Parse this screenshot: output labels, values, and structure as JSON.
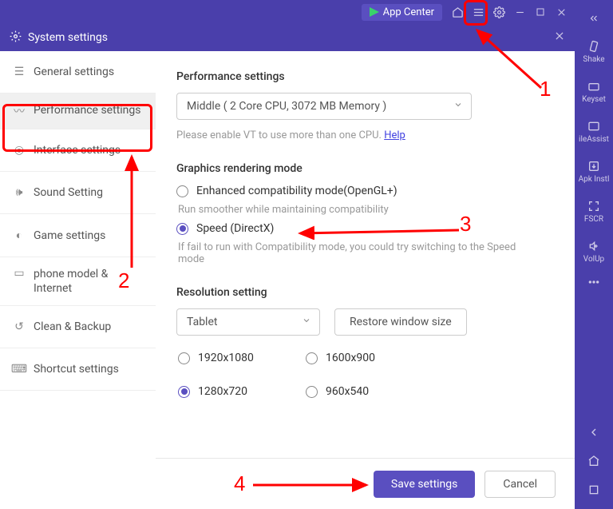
{
  "menubar": {
    "appcenter_label": "App Center"
  },
  "titlebar": {
    "title": "System settings"
  },
  "sidebar": {
    "items": [
      {
        "label": "General settings"
      },
      {
        "label": "Performance settings"
      },
      {
        "label": "Interface settings"
      },
      {
        "label": "Sound Setting"
      },
      {
        "label": "Game settings"
      },
      {
        "label": "phone model & Internet"
      },
      {
        "label": "Clean & Backup"
      },
      {
        "label": "Shortcut settings"
      }
    ]
  },
  "perf": {
    "title": "Performance settings",
    "select_value": "Middle ( 2 Core CPU, 3072 MB Memory )",
    "hint_prefix": "Please enable VT to use more than one CPU. ",
    "hint_link": "Help"
  },
  "gfx": {
    "title": "Graphics rendering mode",
    "opt1": "Enhanced compatibility mode(OpenGL+)",
    "opt1_hint": "Run smoother while maintaining compatibility",
    "opt2": "Speed (DirectX)",
    "opt2_hint": " If fail to run with Compatibility mode, you could try switching to the Speed mode"
  },
  "res": {
    "title": "Resolution setting",
    "mode_value": "Tablet",
    "restore_label": "Restore window size",
    "opts": [
      "1920x1080",
      "1600x900",
      "1280x720",
      "960x540"
    ]
  },
  "footer": {
    "save": "Save settings",
    "cancel": "Cancel"
  },
  "rightpanel": {
    "items": [
      "Shake",
      "Keyset",
      "ileAssist",
      "Apk Instl",
      "FSCR",
      "VolUp"
    ]
  },
  "annotations": {
    "n1": "1",
    "n2": "2",
    "n3": "3",
    "n4": "4"
  }
}
